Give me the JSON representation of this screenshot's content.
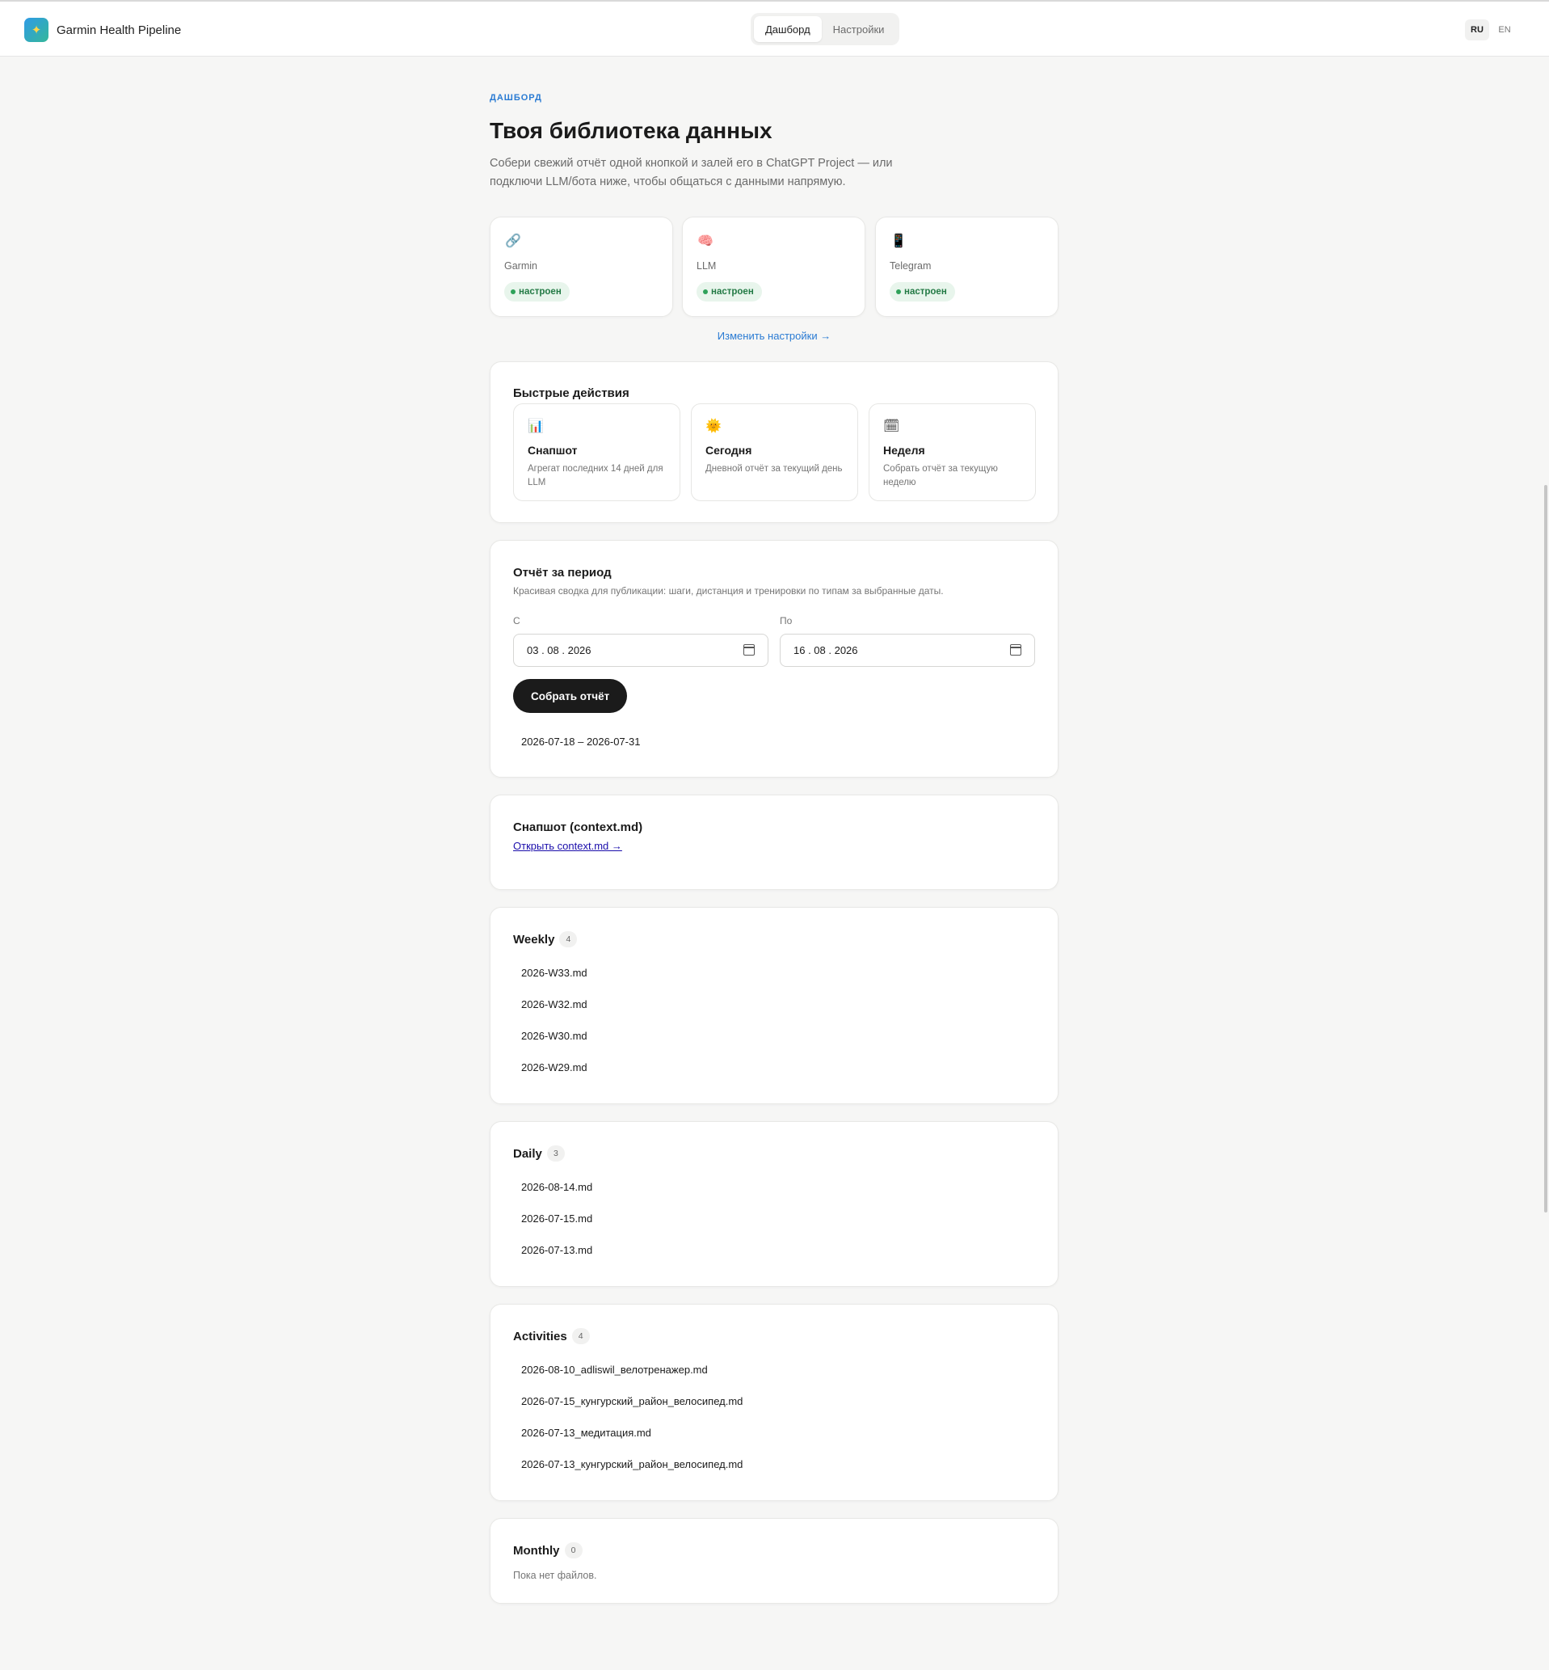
{
  "app": {
    "title": "Garmin Health Pipeline",
    "logo_icon": "sparkle-icon"
  },
  "nav": {
    "tabs": [
      "Дашборд",
      "Настройки"
    ],
    "active": "Дашборд"
  },
  "lang": {
    "options": [
      "RU",
      "EN"
    ],
    "active": "RU"
  },
  "page": {
    "kicker": "ДАШБОРД",
    "title": "Твоя библиотека данных",
    "subtitle": "Собери свежий отчёт одной кнопкой и залей его в ChatGPT Project — или подключи LLM/бота ниже, чтобы общаться с данными напрямую."
  },
  "status": [
    {
      "name": "Garmin",
      "icon": "🔗",
      "status": "настроен"
    },
    {
      "name": "LLM",
      "icon": "🧠",
      "status": "настроен"
    },
    {
      "name": "Telegram",
      "icon": "📱",
      "status": "настроен"
    }
  ],
  "settings_link": "Изменить настройки →",
  "quick_actions": {
    "title": "Быстрые действия",
    "items": [
      {
        "icon": "📊",
        "title": "Снапшот",
        "desc": "Агрегат последних 14 дней для LLM"
      },
      {
        "icon": "🌞",
        "title": "Сегодня",
        "desc": "Дневной отчёт за текущий день"
      },
      {
        "icon": "🗓",
        "title": "Неделя",
        "desc": "Собрать отчёт за текущую неделю"
      }
    ]
  },
  "period": {
    "title": "Отчёт за период",
    "desc": "Красивая сводка для публикации: шаги, дистанция и тренировки по типам за выбранные даты.",
    "from_label": "С",
    "to_label": "По",
    "from_value": "03 . 08 . 2026",
    "to_value": "16 . 08 . 2026",
    "button": "Собрать отчёт",
    "result": "2026-07-18 – 2026-07-31"
  },
  "snapshot": {
    "title": "Снапшот (context.md)",
    "link": "Открыть context.md →"
  },
  "weekly": {
    "title": "Weekly",
    "count": "4",
    "files": [
      "2026-W33.md",
      "2026-W32.md",
      "2026-W30.md",
      "2026-W29.md"
    ]
  },
  "daily": {
    "title": "Daily",
    "count": "3",
    "files": [
      "2026-08-14.md",
      "2026-07-15.md",
      "2026-07-13.md"
    ]
  },
  "activities": {
    "title": "Activities",
    "count": "4",
    "files": [
      "2026-08-10_adliswil_велотренажер.md",
      "2026-07-15_кунгурский_район_велосипед.md",
      "2026-07-13_медитация.md",
      "2026-07-13_кунгурский_район_велосипед.md"
    ]
  },
  "monthly": {
    "title": "Monthly",
    "count": "0",
    "empty": "Пока нет файлов."
  }
}
